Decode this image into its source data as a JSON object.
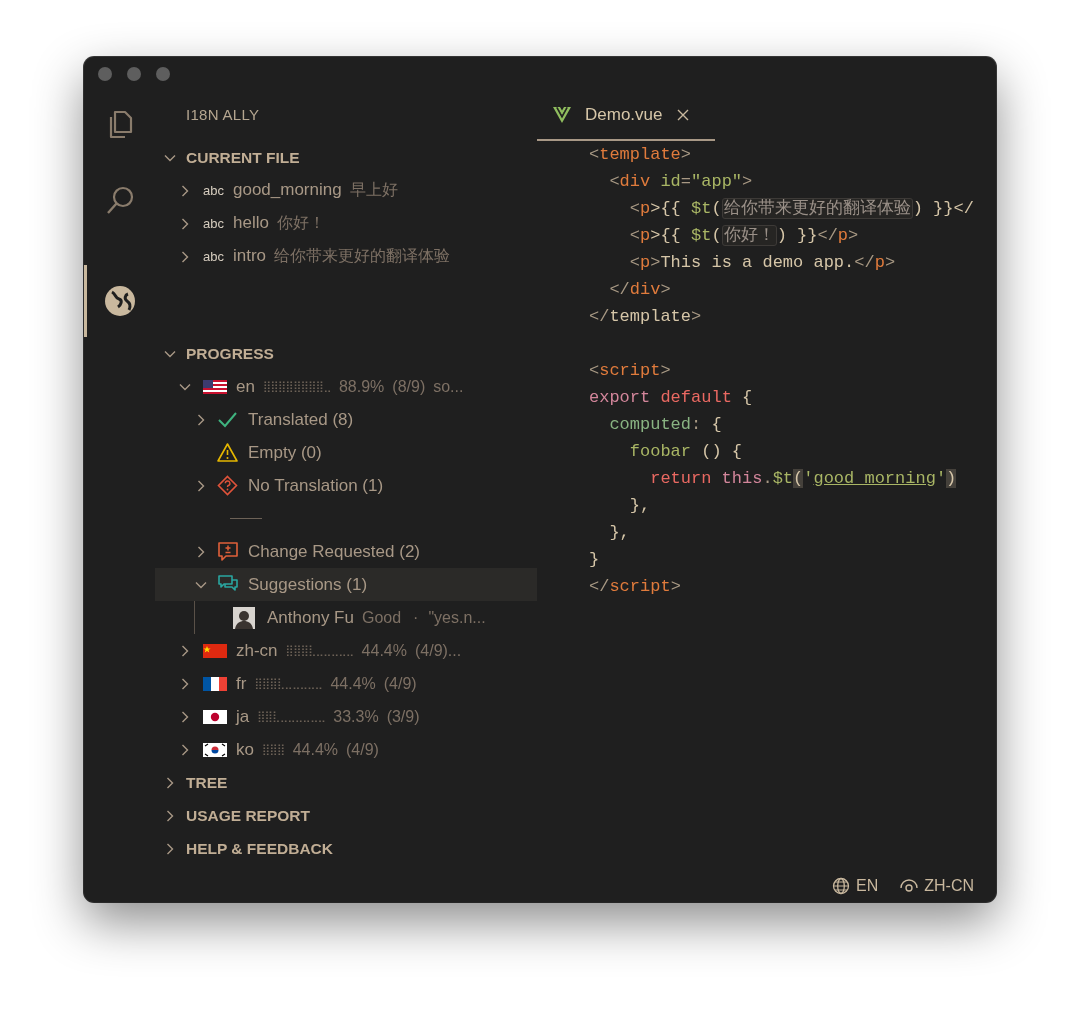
{
  "activity_bar": [
    {
      "kind": "files",
      "selected": false
    },
    {
      "kind": "search",
      "selected": false
    },
    {
      "kind": "globe",
      "selected": true
    }
  ],
  "sidebar": {
    "title": "I18N ALLY",
    "sections": [
      {
        "kind": "current_file",
        "heading": "CURRENT FILE",
        "expanded": true,
        "items": [
          {
            "symbol": "abc",
            "key": "good_morning",
            "value": "早上好",
            "expanded": false
          },
          {
            "symbol": "abc",
            "key": "hello",
            "value": "你好！",
            "expanded": false
          },
          {
            "symbol": "abc",
            "key": "intro",
            "value": "给你带来更好的翻译体验",
            "expanded": false
          }
        ]
      },
      {
        "kind": "progress",
        "heading": "PROGRESS",
        "expanded": true,
        "locales": [
          {
            "kind": "us",
            "code": "en",
            "bar": "⣿⣿⣿⣿⣿⣿⣿⣿⣀",
            "percent": "88.9%",
            "count": "(8/9)",
            "extra": "so...",
            "expanded": true,
            "children": [
              {
                "kind": "translated",
                "label": "Translated (8)",
                "leaf": false,
                "expanded": false,
                "selected": false
              },
              {
                "kind": "empty",
                "label": "Empty (0)",
                "leaf": true,
                "expanded": false,
                "selected": false
              },
              {
                "kind": "missing",
                "label": "No Translation (1)",
                "leaf": false,
                "expanded": false,
                "selected": false
              },
              {
                "kind": "separator"
              },
              {
                "kind": "change_requested",
                "label": "Change Requested (2)",
                "leaf": false,
                "expanded": false,
                "selected": false
              },
              {
                "kind": "suggestions",
                "label": "Suggestions (1)",
                "leaf": false,
                "expanded": true,
                "selected": true,
                "children": [
                  {
                    "author": "Anthony Fu",
                    "status": "Good",
                    "dot": "·",
                    "text": "\"yes.n..."
                  }
                ]
              }
            ]
          },
          {
            "kind": "cn",
            "code": "zh-cn",
            "bar": "⣿⣿⣿⣇⣀⣀⣀⣀⣀",
            "percent": "44.4%",
            "count": "(4/9)...",
            "expanded": false
          },
          {
            "kind": "fr",
            "code": "fr",
            "bar": "⣿⣿⣿⣇⣀⣀⣀⣀⣀",
            "percent": "44.4%",
            "count": "(4/9)",
            "expanded": false
          },
          {
            "kind": "jp",
            "code": "ja",
            "bar": "⣿⣿⣇⣀⣀⣀⣀⣀⣀",
            "percent": "33.3%",
            "count": "(3/9)",
            "expanded": false
          },
          {
            "kind": "kr",
            "code": "ko",
            "bar": "⣿⣿⣿",
            "percent": "44.4%",
            "count": "(4/9)",
            "expanded": false
          }
        ]
      },
      {
        "kind": "plain",
        "heading": "TREE",
        "expanded": false
      },
      {
        "kind": "plain",
        "heading": "USAGE REPORT",
        "expanded": false
      },
      {
        "kind": "plain",
        "heading": "HELP & FEEDBACK",
        "expanded": false
      }
    ]
  },
  "editor": {
    "tabs": [
      {
        "title": "Demo.vue",
        "selected": true
      }
    ],
    "lines": [
      {
        "kind": "code",
        "tokens": [
          {
            "kind": "p",
            "text": "<"
          },
          {
            "kind": "tag",
            "text": "template"
          },
          {
            "kind": "p",
            "text": ">"
          }
        ]
      },
      {
        "kind": "code",
        "tokens": [
          {
            "kind": "p",
            "text": "  <"
          },
          {
            "kind": "tag",
            "text": "div"
          },
          {
            "kind": "attr",
            "text": " id"
          },
          {
            "kind": "p",
            "text": "="
          },
          {
            "kind": "str",
            "text": "\"app\""
          },
          {
            "kind": "p",
            "text": ">"
          }
        ]
      },
      {
        "kind": "code",
        "tokens": [
          {
            "kind": "p",
            "text": "    <"
          },
          {
            "kind": "tag",
            "text": "p"
          },
          {
            "kind": "text",
            "text": ">{{ "
          },
          {
            "kind": "func",
            "text": "$t"
          },
          {
            "kind": "text",
            "text": "("
          },
          {
            "kind": "hint",
            "text": "给你带来更好的翻译体验"
          },
          {
            "kind": "text",
            "text": ") }}</"
          }
        ]
      },
      {
        "kind": "code",
        "tokens": [
          {
            "kind": "p",
            "text": "    <"
          },
          {
            "kind": "tag",
            "text": "p"
          },
          {
            "kind": "text",
            "text": ">{{ "
          },
          {
            "kind": "func",
            "text": "$t"
          },
          {
            "kind": "text",
            "text": "("
          },
          {
            "kind": "hint",
            "text": "你好！"
          },
          {
            "kind": "text",
            "text": ") }}"
          },
          {
            "kind": "p",
            "text": "</"
          },
          {
            "kind": "tag",
            "text": "p"
          },
          {
            "kind": "p",
            "text": ">"
          }
        ]
      },
      {
        "kind": "code",
        "tokens": [
          {
            "kind": "p",
            "text": "    <"
          },
          {
            "kind": "tag",
            "text": "p"
          },
          {
            "kind": "p",
            "text": ">"
          },
          {
            "kind": "text",
            "text": "This is a demo app."
          },
          {
            "kind": "p",
            "text": "</"
          },
          {
            "kind": "tag",
            "text": "p"
          },
          {
            "kind": "p",
            "text": ">"
          }
        ]
      },
      {
        "kind": "code",
        "tokens": [
          {
            "kind": "p",
            "text": "  </"
          },
          {
            "kind": "tag",
            "text": "div"
          },
          {
            "kind": "p",
            "text": ">"
          }
        ]
      },
      {
        "kind": "code",
        "tokens": [
          {
            "kind": "p",
            "text": "</"
          },
          {
            "kind": "text",
            "text": "template"
          },
          {
            "kind": "p",
            "text": ">"
          }
        ]
      },
      {
        "kind": "blank"
      },
      {
        "kind": "code",
        "tokens": [
          {
            "kind": "p",
            "text": "<"
          },
          {
            "kind": "tag",
            "text": "script"
          },
          {
            "kind": "p",
            "text": ">"
          }
        ]
      },
      {
        "kind": "code",
        "tokens": [
          {
            "kind": "kw",
            "text": "export"
          },
          {
            "kind": "kw2",
            "text": " default"
          },
          {
            "kind": "text",
            "text": " {"
          }
        ]
      },
      {
        "kind": "code",
        "tokens": [
          {
            "kind": "prop",
            "text": "  computed"
          },
          {
            "kind": "p",
            "text": ":"
          },
          {
            "kind": "text",
            "text": " {"
          }
        ]
      },
      {
        "kind": "code",
        "tokens": [
          {
            "kind": "func",
            "text": "    foobar"
          },
          {
            "kind": "text",
            "text": " () {"
          }
        ]
      },
      {
        "kind": "code",
        "tokens": [
          {
            "kind": "kw2",
            "text": "      return"
          },
          {
            "kind": "kw",
            "text": " this"
          },
          {
            "kind": "p",
            "text": "."
          },
          {
            "kind": "func",
            "text": "$t"
          },
          {
            "kind": "brk",
            "text": "("
          },
          {
            "kind": "str",
            "text": "'"
          },
          {
            "kind": "link",
            "text": "good_morning"
          },
          {
            "kind": "str",
            "text": "'"
          },
          {
            "kind": "brk",
            "text": ")"
          }
        ]
      },
      {
        "kind": "code",
        "tokens": [
          {
            "kind": "text",
            "text": "    },"
          }
        ]
      },
      {
        "kind": "code",
        "tokens": [
          {
            "kind": "text",
            "text": "  },"
          }
        ]
      },
      {
        "kind": "code",
        "tokens": [
          {
            "kind": "text",
            "text": "}"
          }
        ]
      },
      {
        "kind": "code",
        "tokens": [
          {
            "kind": "p",
            "text": "</"
          },
          {
            "kind": "tag",
            "text": "script"
          },
          {
            "kind": "p",
            "text": ">"
          }
        ]
      }
    ]
  },
  "status_bar": [
    {
      "kind": "globe",
      "label": "EN"
    },
    {
      "kind": "eye",
      "label": "ZH-CN"
    }
  ]
}
